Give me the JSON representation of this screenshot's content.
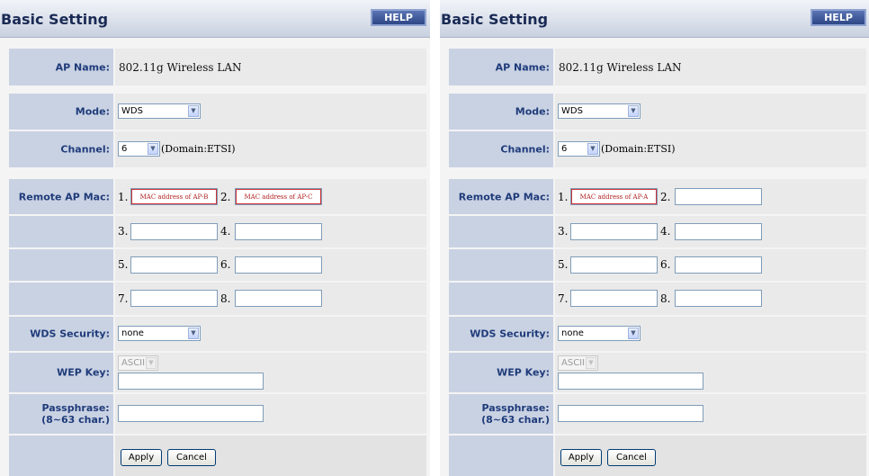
{
  "left": {
    "title": "Basic Setting",
    "help_label": "HELP",
    "ap_name_label": "AP Name:",
    "ap_name_value": "802.11g Wireless LAN",
    "mode_label": "Mode:",
    "mode_value": "WDS",
    "channel_label": "Channel:",
    "channel_value": "6",
    "domain_text": "(Domain:ETSI)",
    "remote_label": "Remote AP Mac:",
    "mac": [
      {
        "num": "1.",
        "value": "",
        "hint": "MAC address of AP-B"
      },
      {
        "num": "2.",
        "value": "",
        "hint": "MAC address of AP-C"
      },
      {
        "num": "3.",
        "value": ""
      },
      {
        "num": "4.",
        "value": ""
      },
      {
        "num": "5.",
        "value": ""
      },
      {
        "num": "6.",
        "value": ""
      },
      {
        "num": "7.",
        "value": ""
      },
      {
        "num": "8.",
        "value": ""
      }
    ],
    "security_label": "WDS Security:",
    "security_value": "none",
    "wep_label": "WEP Key:",
    "wep_format": "ASCII",
    "wep_value": "",
    "pass_label_1": "Passphrase:",
    "pass_label_2": "(8~63 char.)",
    "pass_value": "",
    "apply_label": "Apply",
    "cancel_label": "Cancel"
  },
  "right": {
    "title": "Basic Setting",
    "help_label": "HELP",
    "ap_name_label": "AP Name:",
    "ap_name_value": "802.11g Wireless LAN",
    "mode_label": "Mode:",
    "mode_value": "WDS",
    "channel_label": "Channel:",
    "channel_value": "6",
    "domain_text": "(Domain:ETSI)",
    "remote_label": "Remote AP Mac:",
    "mac": [
      {
        "num": "1.",
        "value": "",
        "hint": "MAC address of AP-A"
      },
      {
        "num": "2.",
        "value": ""
      },
      {
        "num": "3.",
        "value": ""
      },
      {
        "num": "4.",
        "value": ""
      },
      {
        "num": "5.",
        "value": ""
      },
      {
        "num": "6.",
        "value": ""
      },
      {
        "num": "7.",
        "value": ""
      },
      {
        "num": "8.",
        "value": ""
      }
    ],
    "security_label": "WDS Security:",
    "security_value": "none",
    "wep_label": "WEP Key:",
    "wep_format": "ASCII",
    "wep_value": "",
    "pass_label_1": "Passphrase:",
    "pass_label_2": "(8~63 char.)",
    "pass_value": "",
    "apply_label": "Apply",
    "cancel_label": "Cancel"
  }
}
